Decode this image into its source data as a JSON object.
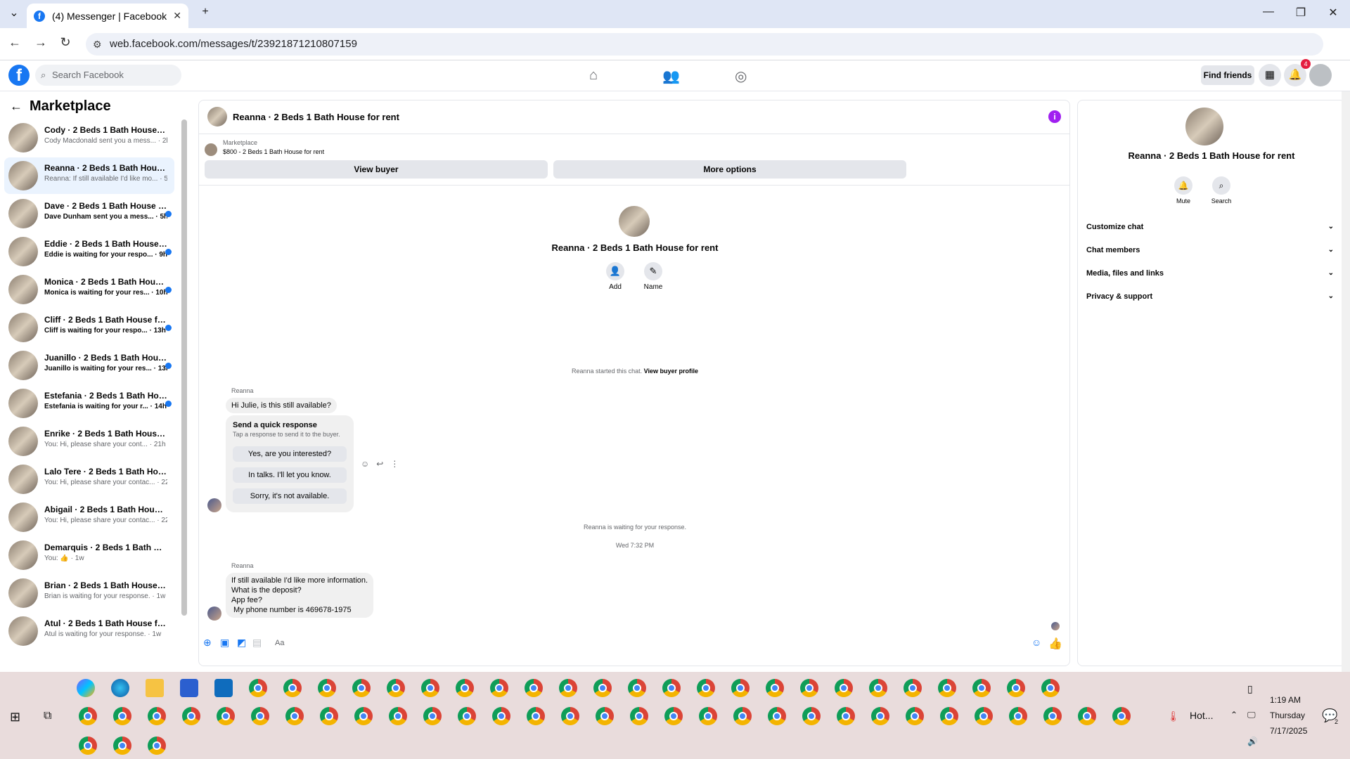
{
  "browser": {
    "tab_title": "(4) Messenger | Facebook",
    "url": "web.facebook.com/messages/t/23921871210807159"
  },
  "fb": {
    "search_placeholder": "Search Facebook",
    "find_friends": "Find friends",
    "notif_count": "4"
  },
  "sidebar": {
    "title": "Marketplace",
    "conversations": [
      {
        "title": "Cody · 2 Beds 1 Bath House for ...",
        "preview": "Cody Macdonald sent you a mess... · 2h",
        "unread": false
      },
      {
        "title": "Reanna · 2 Beds 1 Bath House f...",
        "preview": "Reanna: If still available I'd like mo... · 5h",
        "unread": false,
        "selected": true
      },
      {
        "title": "Dave · 2 Beds 1 Bath House fo...",
        "preview": "Dave Dunham sent you a mess... · 5h",
        "unread": true
      },
      {
        "title": "Eddie · 2 Beds 1 Bath House f...",
        "preview": "Eddie is waiting for your respo... · 9h",
        "unread": true
      },
      {
        "title": "Monica · 2 Beds 1 Bath House...",
        "preview": "Monica is waiting for your res... · 10h",
        "unread": true
      },
      {
        "title": "Cliff · 2 Beds 1 Bath House for...",
        "preview": "Cliff is waiting for your respo... · 13h",
        "unread": true
      },
      {
        "title": "Juanillo · 2 Beds 1 Bath House...",
        "preview": "Juanillo is waiting for your res... · 13h",
        "unread": true
      },
      {
        "title": "Estefania · 2 Beds 1 Bath Hous...",
        "preview": "Estefania is waiting for your r... · 14h",
        "unread": true
      },
      {
        "title": "Enrike · 2 Beds 1 Bath House ...",
        "preview": "You: Hi, please share your cont... · 21h",
        "unread": false
      },
      {
        "title": "Lalo Tere · 2 Beds 1 Bath House ...",
        "preview": "You: Hi, please share your contac... · 22h",
        "unread": false
      },
      {
        "title": "Abigail · 2 Beds 1 Bath House fo...",
        "preview": "You: Hi, please share your contac... · 22h",
        "unread": false
      },
      {
        "title": "Demarquis · 2 Beds 1 Bath Ho...",
        "preview": "You: 👍 · 1w",
        "unread": false
      },
      {
        "title": "Brian · 2 Beds 1 Bath House for ...",
        "preview": "Brian is waiting for your response. · 1w",
        "unread": false
      },
      {
        "title": "Atul · 2 Beds 1 Bath House for r...",
        "preview": "Atul is waiting for your response. · 1w",
        "unread": false
      }
    ]
  },
  "chat": {
    "title": "Reanna · 2 Beds 1 Bath House for rent",
    "listing_source": "Marketplace",
    "listing_label": "$800 - 2 Beds 1 Bath House for rent",
    "view_buyer": "View buyer",
    "more_options": "More options",
    "add_label": "Add",
    "name_label": "Name",
    "started_text": "Reanna started this chat.",
    "view_profile": "View buyer profile",
    "sender": "Reanna",
    "first_message": "Hi Julie, is this still available?",
    "quick_title": "Send a quick response",
    "quick_sub": "Tap a response to send it to the buyer.",
    "quick_replies": [
      "Yes, are you interested?",
      "In talks. I'll let you know.",
      "Sorry, it's not available."
    ],
    "waiting": "Reanna is waiting for your response.",
    "timestamp": "Wed 7:32 PM",
    "second_message_lines": [
      "If still available I'd like more information.",
      "What is the deposit?",
      "App fee?",
      " My phone number is 469678-1975"
    ],
    "composer_placeholder": "Aa"
  },
  "panel": {
    "name": "Reanna · 2 Beds 1 Bath House for rent",
    "mute": "Mute",
    "search": "Search",
    "sections": [
      "Customize chat",
      "Chat members",
      "Media, files and links",
      "Privacy & support"
    ]
  },
  "taskbar": {
    "time": "1:19 AM",
    "day": "Thursday",
    "date": "7/17/2025",
    "weather": "Hot...",
    "notif_count": "2"
  }
}
